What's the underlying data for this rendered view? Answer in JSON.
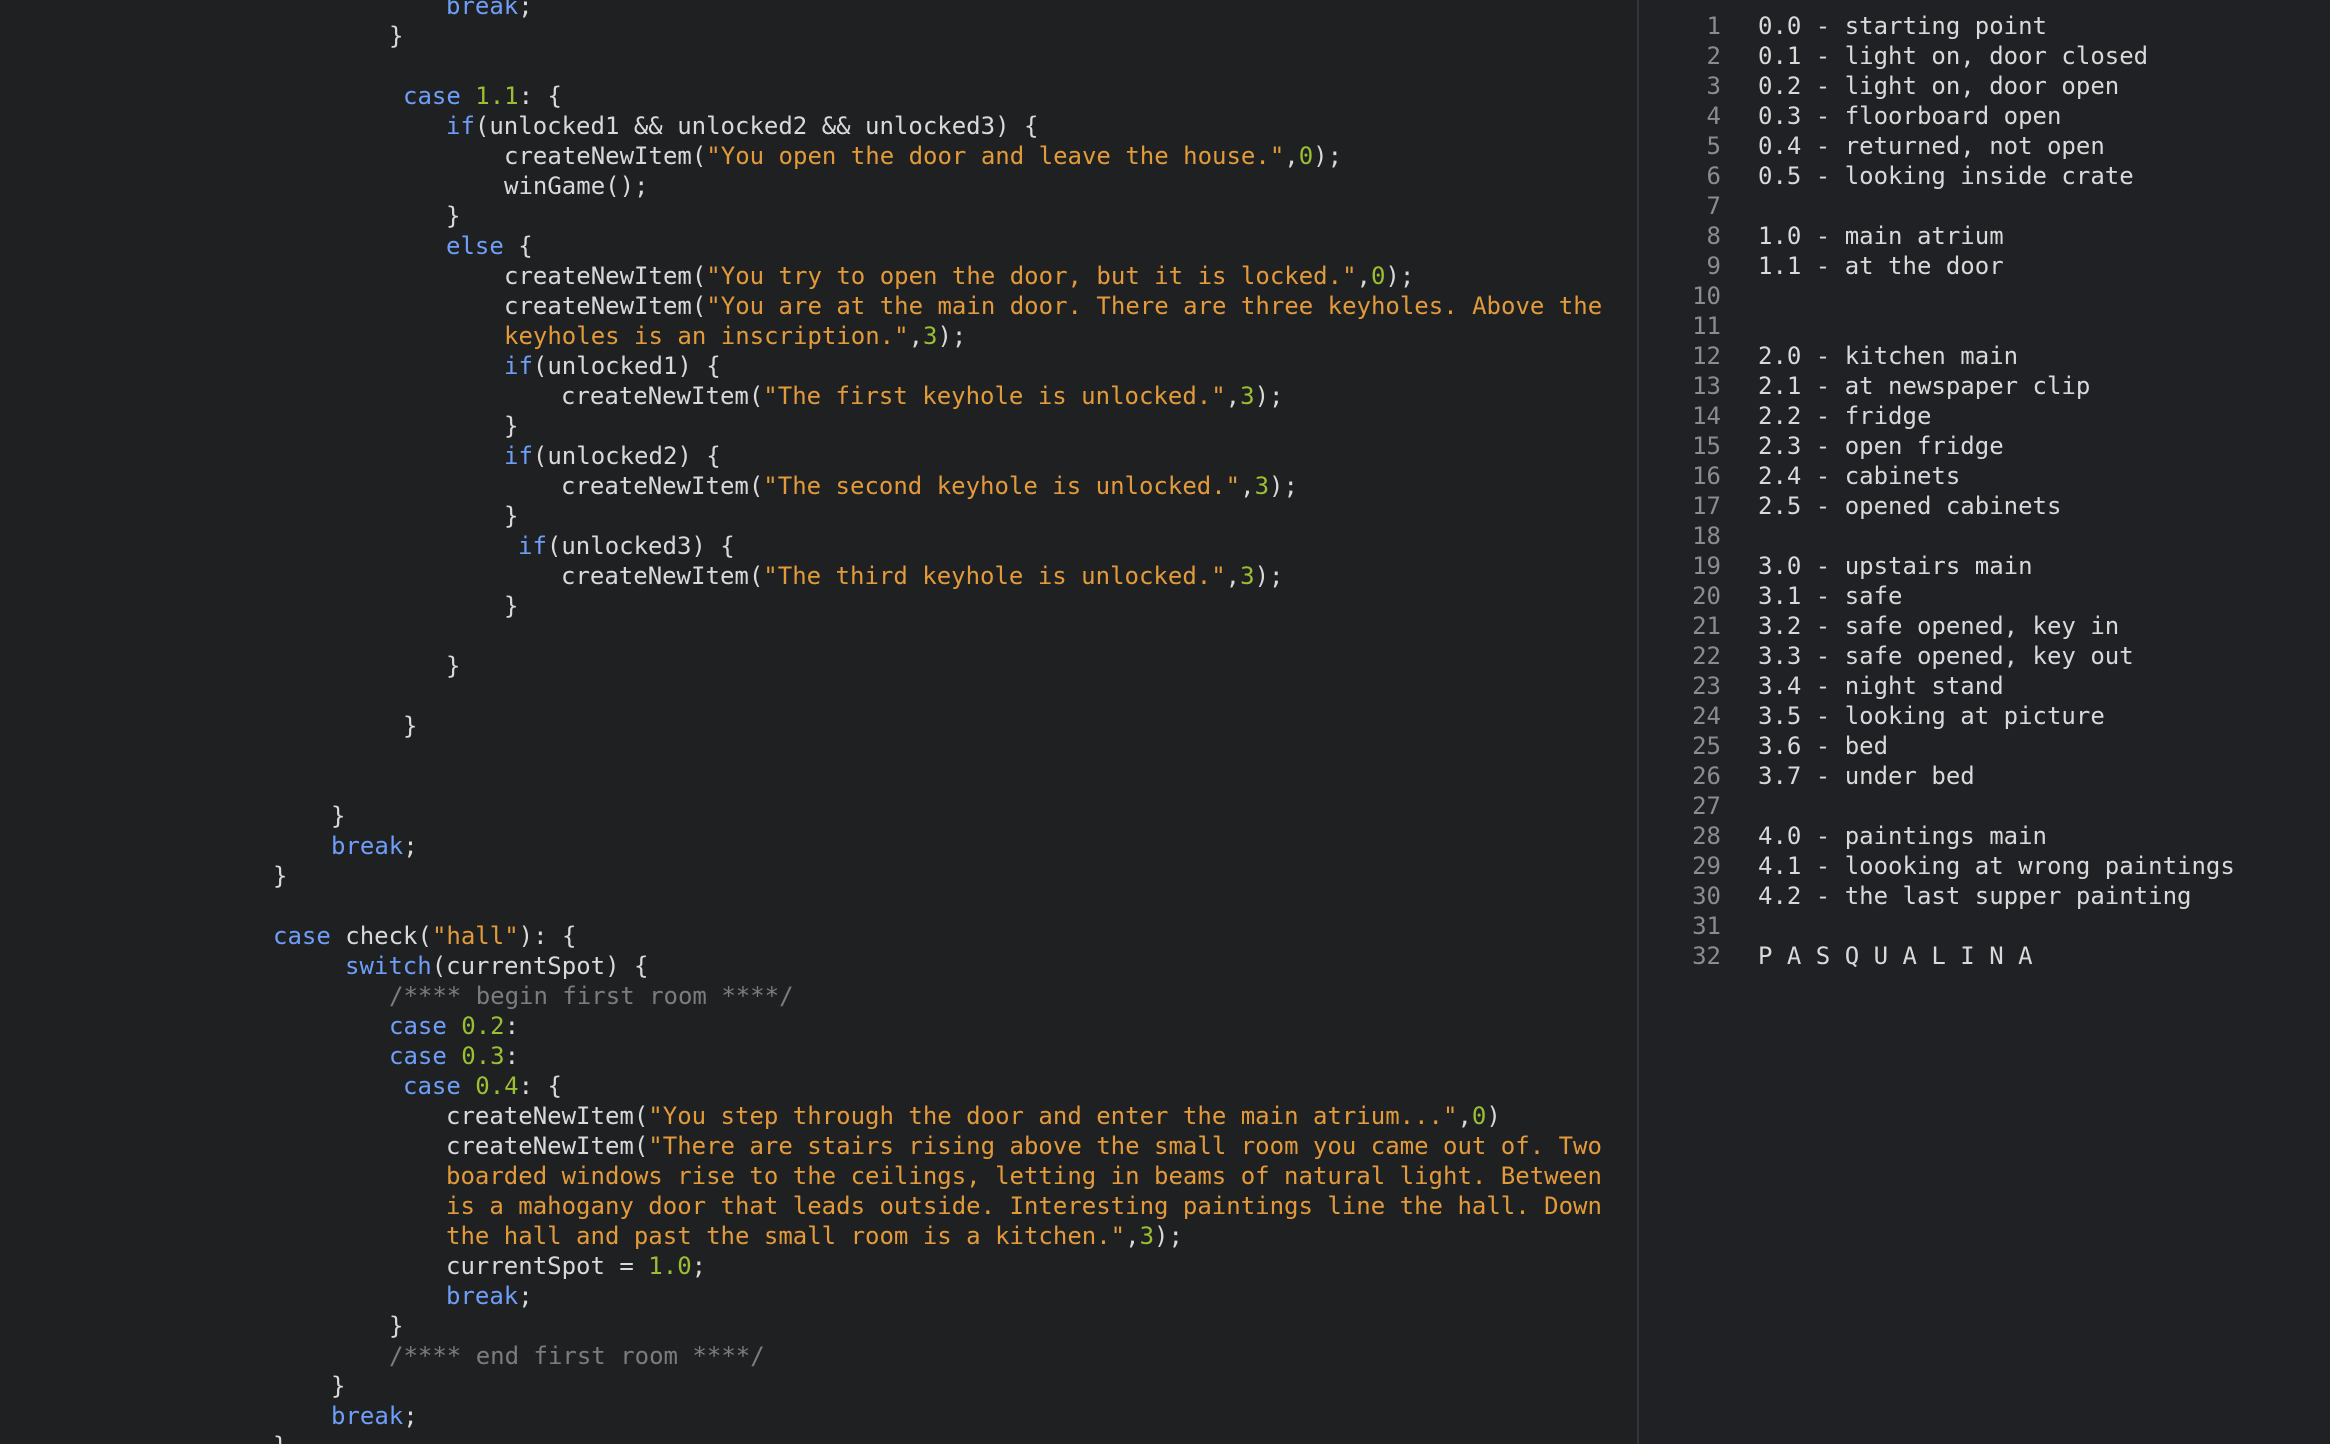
{
  "colors": {
    "background": "#1f2022",
    "keyword": "#6f9ef8",
    "string": "#e29a3b",
    "number": "#9bbf33",
    "comment": "#7a7c80",
    "plain": "#d9d9d9",
    "line_number": "#8a8c90"
  },
  "editor": {
    "lines": [
      [
        [
          "kw",
          "break"
        ],
        [
          "pl",
          ";"
        ]
      ],
      [
        [
          "pl",
          "}"
        ]
      ],
      [],
      [
        [
          "kw",
          "case"
        ],
        [
          "pl",
          " "
        ],
        [
          "num",
          "1.1"
        ],
        [
          "pl",
          ": {"
        ]
      ],
      [
        [
          "kw",
          "if"
        ],
        [
          "pl",
          "(unlocked1 && unlocked2 && unlocked3) {"
        ]
      ],
      [
        [
          "pl",
          "createNewItem("
        ],
        [
          "str",
          "\"You open the door and leave the house.\""
        ],
        [
          "pl",
          ","
        ],
        [
          "num",
          "0"
        ],
        [
          "pl",
          ");"
        ]
      ],
      [
        [
          "pl",
          "winGame();"
        ]
      ],
      [
        [
          "pl",
          "}"
        ]
      ],
      [
        [
          "kw",
          "else"
        ],
        [
          "pl",
          " {"
        ]
      ],
      [
        [
          "pl",
          "createNewItem("
        ],
        [
          "str",
          "\"You try to open the door, but it is locked.\""
        ],
        [
          "pl",
          ","
        ],
        [
          "num",
          "0"
        ],
        [
          "pl",
          ");"
        ]
      ],
      [
        [
          "pl",
          "createNewItem("
        ],
        [
          "str",
          "\"You are at the main door. There are three keyholes. Above the"
        ]
      ],
      [
        [
          "str",
          "keyholes is an inscription.\""
        ],
        [
          "pl",
          ","
        ],
        [
          "num",
          "3"
        ],
        [
          "pl",
          ");"
        ]
      ],
      [
        [
          "kw",
          "if"
        ],
        [
          "pl",
          "(unlocked1) {"
        ]
      ],
      [
        [
          "pl",
          "createNewItem("
        ],
        [
          "str",
          "\"The first keyhole is unlocked.\""
        ],
        [
          "pl",
          ","
        ],
        [
          "num",
          "3"
        ],
        [
          "pl",
          ");"
        ]
      ],
      [
        [
          "pl",
          "}"
        ]
      ],
      [
        [
          "kw",
          "if"
        ],
        [
          "pl",
          "(unlocked2) {"
        ]
      ],
      [
        [
          "pl",
          "createNewItem("
        ],
        [
          "str",
          "\"The second keyhole is unlocked.\""
        ],
        [
          "pl",
          ","
        ],
        [
          "num",
          "3"
        ],
        [
          "pl",
          ");"
        ]
      ],
      [
        [
          "pl",
          "}"
        ]
      ],
      [
        [
          "kw",
          "if"
        ],
        [
          "pl",
          "(unlocked3) {"
        ]
      ],
      [
        [
          "pl",
          "createNewItem("
        ],
        [
          "str",
          "\"The third keyhole is unlocked.\""
        ],
        [
          "pl",
          ","
        ],
        [
          "num",
          "3"
        ],
        [
          "pl",
          ");"
        ]
      ],
      [
        [
          "pl",
          "}"
        ]
      ],
      [],
      [
        [
          "pl",
          "}"
        ]
      ],
      [],
      [
        [
          "pl",
          "}"
        ]
      ],
      [],
      [],
      [
        [
          "pl",
          "}"
        ]
      ],
      [
        [
          "kw",
          "break"
        ],
        [
          "pl",
          ";"
        ]
      ],
      [
        [
          "pl",
          "}"
        ]
      ],
      [],
      [
        [
          "kw",
          "case"
        ],
        [
          "pl",
          " check("
        ],
        [
          "str",
          "\"hall\""
        ],
        [
          "pl",
          "): {"
        ]
      ],
      [
        [
          "kw",
          "switch"
        ],
        [
          "pl",
          "(currentSpot) {"
        ]
      ],
      [
        [
          "cm",
          "/**** begin first room ****/"
        ]
      ],
      [
        [
          "kw",
          "case"
        ],
        [
          "pl",
          " "
        ],
        [
          "num",
          "0.2"
        ],
        [
          "pl",
          ":"
        ]
      ],
      [
        [
          "kw",
          "case"
        ],
        [
          "pl",
          " "
        ],
        [
          "num",
          "0.3"
        ],
        [
          "pl",
          ":"
        ]
      ],
      [
        [
          "kw",
          "case"
        ],
        [
          "pl",
          " "
        ],
        [
          "num",
          "0.4"
        ],
        [
          "pl",
          ": {"
        ]
      ],
      [
        [
          "pl",
          "createNewItem("
        ],
        [
          "str",
          "\"You step through the door and enter the main atrium...\""
        ],
        [
          "pl",
          ","
        ],
        [
          "num",
          "0"
        ],
        [
          "pl",
          ")"
        ]
      ],
      [
        [
          "pl",
          "createNewItem("
        ],
        [
          "str",
          "\"There are stairs rising above the small room you came out of. Two"
        ]
      ],
      [
        [
          "str",
          "boarded windows rise to the ceilings, letting in beams of natural light. Between"
        ]
      ],
      [
        [
          "str",
          "is a mahogany door that leads outside. Interesting paintings line the hall. Down"
        ]
      ],
      [
        [
          "str",
          "the hall and past the small room is a kitchen.\""
        ],
        [
          "pl",
          ","
        ],
        [
          "num",
          "3"
        ],
        [
          "pl",
          ");"
        ]
      ],
      [
        [
          "pl",
          "currentSpot = "
        ],
        [
          "num",
          "1.0"
        ],
        [
          "pl",
          ";"
        ]
      ],
      [
        [
          "kw",
          "break"
        ],
        [
          "pl",
          ";"
        ]
      ],
      [
        [
          "pl",
          "}"
        ]
      ],
      [
        [
          "cm",
          "/**** end first room ****/"
        ]
      ],
      [
        [
          "pl",
          "}"
        ]
      ],
      [
        [
          "kw",
          "break"
        ],
        [
          "pl",
          ";"
        ]
      ],
      [
        [
          "pl",
          "}"
        ]
      ]
    ]
  },
  "notes": {
    "items": [
      {
        "num": "1",
        "text": "0.0 - starting point"
      },
      {
        "num": "2",
        "text": "0.1 - light on, door closed"
      },
      {
        "num": "3",
        "text": "0.2 - light on, door open"
      },
      {
        "num": "4",
        "text": "0.3 - floorboard open"
      },
      {
        "num": "5",
        "text": "0.4 - returned, not open"
      },
      {
        "num": "6",
        "text": "0.5 - looking inside crate"
      },
      {
        "num": "7",
        "text": ""
      },
      {
        "num": "8",
        "text": "1.0 - main atrium"
      },
      {
        "num": "9",
        "text": "1.1 - at the door"
      },
      {
        "num": "10",
        "text": ""
      },
      {
        "num": "11",
        "text": ""
      },
      {
        "num": "12",
        "text": "2.0 - kitchen main"
      },
      {
        "num": "13",
        "text": "2.1 - at newspaper clip"
      },
      {
        "num": "14",
        "text": "2.2 - fridge"
      },
      {
        "num": "15",
        "text": "2.3 - open fridge"
      },
      {
        "num": "16",
        "text": "2.4 - cabinets"
      },
      {
        "num": "17",
        "text": "2.5 - opened cabinets"
      },
      {
        "num": "18",
        "text": ""
      },
      {
        "num": "19",
        "text": "3.0 - upstairs main"
      },
      {
        "num": "20",
        "text": "3.1 - safe"
      },
      {
        "num": "21",
        "text": "3.2 - safe opened, key in"
      },
      {
        "num": "22",
        "text": "3.3 - safe opened, key out"
      },
      {
        "num": "23",
        "text": "3.4 - night stand"
      },
      {
        "num": "24",
        "text": "3.5 - looking at picture"
      },
      {
        "num": "25",
        "text": "3.6 - bed"
      },
      {
        "num": "26",
        "text": "3.7 - under bed"
      },
      {
        "num": "27",
        "text": ""
      },
      {
        "num": "28",
        "text": "4.0 - paintings main"
      },
      {
        "num": "29",
        "text": "4.1 - loooking at wrong paintings"
      },
      {
        "num": "30",
        "text": "4.2 - the last supper painting"
      },
      {
        "num": "31",
        "text": ""
      },
      {
        "num": "32",
        "text": "P A S Q U A L I N A"
      }
    ]
  }
}
